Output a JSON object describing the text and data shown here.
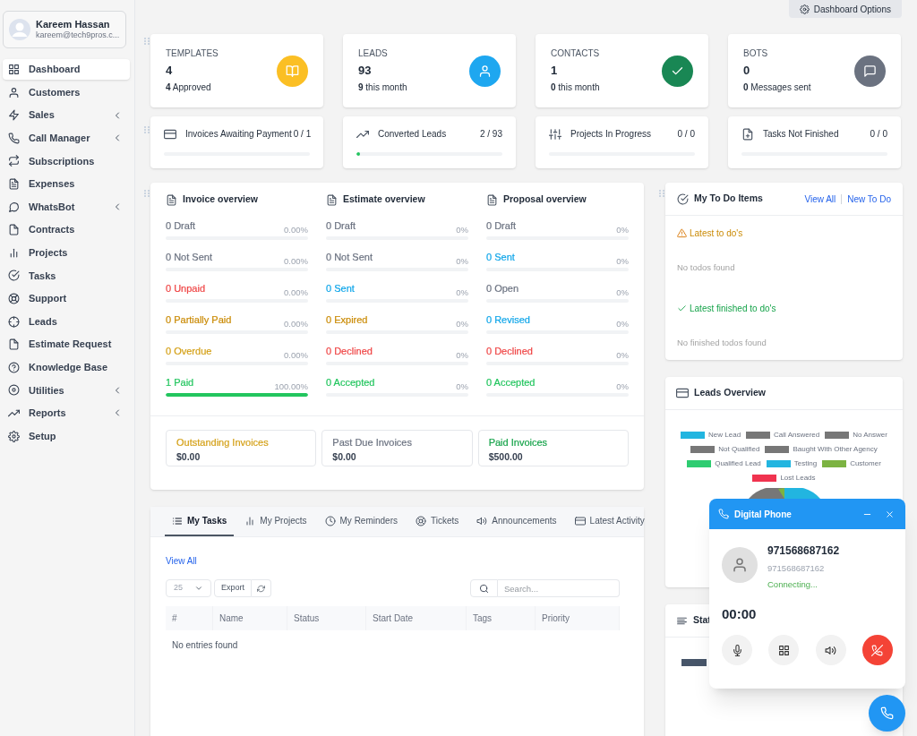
{
  "user": {
    "name": "Kareem Hassan",
    "email": "kareem@tech9pros.c..."
  },
  "sidebar": {
    "items": [
      {
        "label": "Dashboard",
        "selected": true,
        "has_submenu": false
      },
      {
        "label": "Customers",
        "selected": false,
        "has_submenu": false
      },
      {
        "label": "Sales",
        "selected": false,
        "has_submenu": true
      },
      {
        "label": "Call Manager",
        "selected": false,
        "has_submenu": true
      },
      {
        "label": "Subscriptions",
        "selected": false,
        "has_submenu": false
      },
      {
        "label": "Expenses",
        "selected": false,
        "has_submenu": false
      },
      {
        "label": "WhatsBot",
        "selected": false,
        "has_submenu": true
      },
      {
        "label": "Contracts",
        "selected": false,
        "has_submenu": false
      },
      {
        "label": "Projects",
        "selected": false,
        "has_submenu": false
      },
      {
        "label": "Tasks",
        "selected": false,
        "has_submenu": false
      },
      {
        "label": "Support",
        "selected": false,
        "has_submenu": false
      },
      {
        "label": "Leads",
        "selected": false,
        "has_submenu": false
      },
      {
        "label": "Estimate Request",
        "selected": false,
        "has_submenu": false
      },
      {
        "label": "Knowledge Base",
        "selected": false,
        "has_submenu": false
      },
      {
        "label": "Utilities",
        "selected": false,
        "has_submenu": true
      },
      {
        "label": "Reports",
        "selected": false,
        "has_submenu": true
      },
      {
        "label": "Setup",
        "selected": false,
        "has_submenu": false
      }
    ]
  },
  "dashboard_options": "Dashboard Options",
  "stat_cards": [
    {
      "title": "TEMPLATES",
      "value": "4",
      "sub": "**4** Approved",
      "color": "#fbbf24"
    },
    {
      "title": "LEADS",
      "value": "93",
      "sub": "**9** this month",
      "color": "#1ea7f0"
    },
    {
      "title": "CONTACTS",
      "value": "1",
      "sub": "**0** this month",
      "color": "#198754"
    },
    {
      "title": "BOTS",
      "value": "0",
      "sub": "**0** Messages sent",
      "color": "#6b7280"
    }
  ],
  "progress_cards": [
    {
      "label": "Invoices Awaiting Payment",
      "value": "0 / 1",
      "level": 0
    },
    {
      "label": "Converted Leads",
      "value": "2 / 93",
      "level": 0.0215
    },
    {
      "label": "Projects In Progress",
      "value": "0 / 0",
      "level": 0
    },
    {
      "label": "Tasks Not Finished",
      "value": "0 / 0",
      "level": 0
    }
  ],
  "overview": {
    "columns": [
      {
        "title": "Invoice overview",
        "rows": [
          {
            "label": "0 Draft",
            "percent": "0.00%",
            "level": 0,
            "color": "#6b7280"
          },
          {
            "label": "0 Not Sent",
            "percent": "0.00%",
            "level": 0,
            "color": "#6b7280"
          },
          {
            "label": "0 Unpaid",
            "percent": "0.00%",
            "level": 0,
            "color": "#ef4444"
          },
          {
            "label": "0 Partially Paid",
            "percent": "0.00%",
            "level": 0,
            "color": "#ca8a04"
          },
          {
            "label": "0 Overdue",
            "percent": "0.00%",
            "level": 0,
            "color": "#d4a017"
          },
          {
            "label": "1 Paid",
            "percent": "100.00%",
            "level": 1,
            "color": "#22c55e"
          }
        ]
      },
      {
        "title": "Estimate overview",
        "rows": [
          {
            "label": "0 Draft",
            "percent": "0%",
            "level": 0,
            "color": "#6b7280"
          },
          {
            "label": "0 Not Sent",
            "percent": "0%",
            "level": 0,
            "color": "#6b7280"
          },
          {
            "label": "0 Sent",
            "percent": "0%",
            "level": 0,
            "color": "#0ea5e9"
          },
          {
            "label": "0 Expired",
            "percent": "0%",
            "level": 0,
            "color": "#ca8a04"
          },
          {
            "label": "0 Declined",
            "percent": "0%",
            "level": 0,
            "color": "#ef4444"
          },
          {
            "label": "0 Accepted",
            "percent": "0%",
            "level": 0,
            "color": "#22c55e"
          }
        ]
      },
      {
        "title": "Proposal overview",
        "rows": [
          {
            "label": "0 Draft",
            "percent": "0%",
            "level": 0,
            "color": "#6b7280"
          },
          {
            "label": "0 Sent",
            "percent": "0%",
            "level": 0,
            "color": "#0ea5e9"
          },
          {
            "label": "0 Open",
            "percent": "0%",
            "level": 0,
            "color": "#6b7280"
          },
          {
            "label": "0 Revised",
            "percent": "0%",
            "level": 0,
            "color": "#0ea5e9"
          },
          {
            "label": "0 Declined",
            "percent": "0%",
            "level": 0,
            "color": "#ef4444"
          },
          {
            "label": "0 Accepted",
            "percent": "0%",
            "level": 0,
            "color": "#22c55e"
          }
        ]
      }
    ],
    "summaries": [
      {
        "label": "Outstanding Invoices",
        "amount": "$0.00",
        "color": "#d4a017"
      },
      {
        "label": "Past Due Invoices",
        "amount": "$0.00",
        "color": "#6b7280"
      },
      {
        "label": "Paid Invoices",
        "amount": "$500.00",
        "color": "#16a34a"
      }
    ]
  },
  "todo": {
    "title": "My To Do Items",
    "links": [
      "View All",
      "New To Do"
    ],
    "sections": [
      {
        "kind": "pending",
        "title": "Latest to do's",
        "empty": "No todos found"
      },
      {
        "kind": "finished",
        "title": "Latest finished to do's",
        "empty": "No finished todos found"
      }
    ]
  },
  "leads_overview": {
    "title": "Leads Overview",
    "legend": [
      {
        "label": "New Lead",
        "color": "#22b5e0"
      },
      {
        "label": "Call Answered",
        "color": "#777777"
      },
      {
        "label": "No Answer",
        "color": "#777777"
      },
      {
        "label": "Not Qualified",
        "color": "#777777"
      },
      {
        "label": "Baught With Other Agency",
        "color": "#777777"
      },
      {
        "label": "Qualified Lead",
        "color": "#2ecc71"
      },
      {
        "label": "Testing",
        "color": "#22b5e0"
      },
      {
        "label": "Customer",
        "color": "#7cb342"
      },
      {
        "label": "Lost Leads",
        "color": "#f0334f"
      }
    ]
  },
  "stats_card": {
    "title": "Stat"
  },
  "tasks": {
    "tabs": [
      {
        "label": "My Tasks",
        "selected": true
      },
      {
        "label": "My Projects",
        "selected": false
      },
      {
        "label": "My Reminders",
        "selected": false
      },
      {
        "label": "Tickets",
        "selected": false
      },
      {
        "label": "Announcements",
        "selected": false
      },
      {
        "label": "Latest Activity",
        "selected": false
      }
    ],
    "view_all": "View All",
    "page_size": "25",
    "export": "Export",
    "search_placeholder": "Search...",
    "columns": [
      "#",
      "Name",
      "Status",
      "Start Date",
      "Tags",
      "Priority"
    ],
    "empty": "No entries found"
  },
  "phone": {
    "title": "Digital Phone",
    "name": "971568687162",
    "number": "971568687162",
    "status": "Connecting...",
    "timer": "00:00"
  }
}
